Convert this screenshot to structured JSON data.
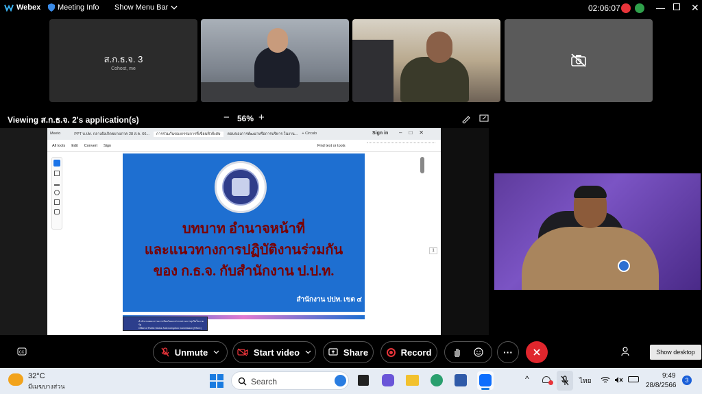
{
  "topbar": {
    "app": "Webex",
    "meeting_info": "Meeting Info",
    "menu_bar": "Show Menu Bar",
    "time": "02:06:07"
  },
  "tiles": [
    {
      "name": "ส.ก.ธ.จ. 3",
      "sub": "Cohost, me"
    }
  ],
  "viewbar": {
    "viewing": "Viewing ส.ก.ธ.จ. 2's application(s)",
    "zoom": "56%",
    "minus": "−",
    "plus": "+"
  },
  "browser": {
    "tabs": [
      "Meeto",
      "PPT บ.ปท. กลางยังเกิดขยายภาค 28 ส.ค. 66...",
      "การร่วมกันของกรรมการที่เขียนทิวพิเศษ",
      "ตอนของการพัฒนาหรือการบริหาร ในงาน..."
    ],
    "new_tab": "+ Circulo",
    "sign_in": "Sign in",
    "toolbar": [
      "All tools",
      "Edit",
      "Convert",
      "Sign"
    ],
    "find": "Find text or tools",
    "page_number": "1"
  },
  "slide": {
    "line1": "บทบาท อำนาจหน้าที่",
    "line2": "และแนวทางการปฏิบัติงานร่วมกัน",
    "line3": "ของ ก.ธ.จ. กับสำนักงาน ป.ป.ท.",
    "footer": "สำนักงาน ปปท. เขต ๔",
    "next_caption1": "สำนักงานคณะกรรมการป้องกันและปราบปรามการทุจริตในภาครัฐ",
    "next_caption2": "Office of Public Sector Anti-Corruption Commission (PACC)"
  },
  "controls": {
    "unmute": "Unmute",
    "start_video": "Start video",
    "share": "Share",
    "record": "Record",
    "more": "···",
    "show_desktop": "Show desktop"
  },
  "taskbar": {
    "temp": "32°C",
    "weather": "มีเมฆบางส่วน",
    "search": "Search",
    "lang": "ไทย",
    "time": "9:49",
    "date": "28/8/2566",
    "badge": "3"
  },
  "colors": {
    "record_red": "#e8343a",
    "slide_blue": "#1e6fd1",
    "slide_title": "#7a0000",
    "hangup": "#e0262d"
  }
}
